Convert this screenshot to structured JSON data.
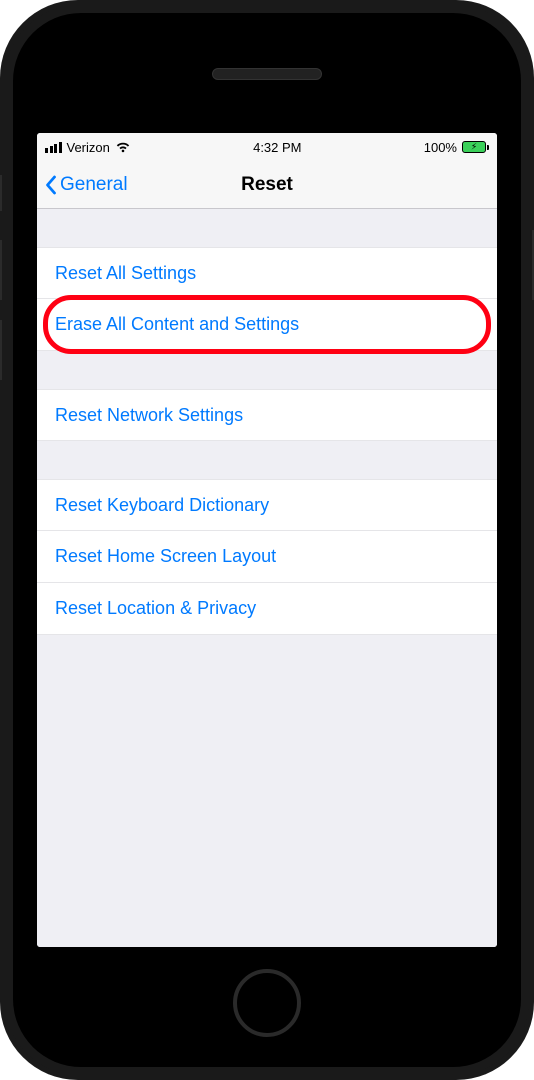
{
  "status": {
    "carrier": "Verizon",
    "time": "4:32 PM",
    "battery_label": "100%"
  },
  "nav": {
    "back_label": "General",
    "title": "Reset"
  },
  "groups": [
    {
      "items": [
        {
          "label": "Reset All Settings"
        },
        {
          "label": "Erase All Content and Settings",
          "highlighted": true
        }
      ]
    },
    {
      "items": [
        {
          "label": "Reset Network Settings"
        }
      ]
    },
    {
      "items": [
        {
          "label": "Reset Keyboard Dictionary"
        },
        {
          "label": "Reset Home Screen Layout"
        },
        {
          "label": "Reset Location & Privacy"
        }
      ]
    }
  ]
}
